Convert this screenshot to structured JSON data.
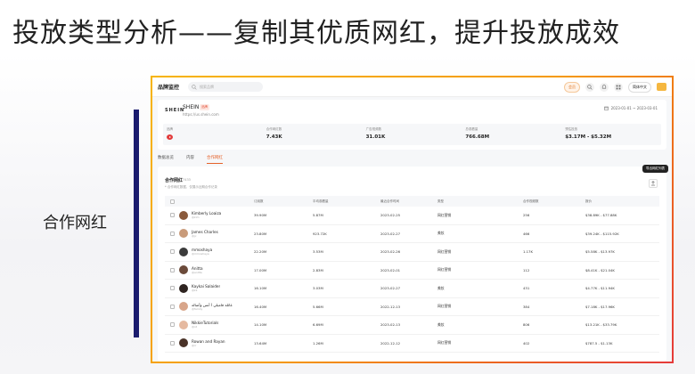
{
  "slide": {
    "title": "投放类型分析——复制其优质网红，提升投放成效",
    "side_label": "合作网红"
  },
  "app": {
    "title": "品牌监控",
    "search_placeholder": "搜索品牌",
    "vip_label": "会员",
    "language": "简体中文"
  },
  "brand": {
    "logo": "SHEIN",
    "name": "SHEIN",
    "badge": "品牌",
    "url": "https://us.shein.com",
    "date_range": "2023-01-01 ~ 2023-03-01",
    "stats": [
      {
        "label": "品牌",
        "value": ""
      },
      {
        "label": "合作网红数",
        "value": "7.43K"
      },
      {
        "label": "广告视频数",
        "value": "31.01K"
      },
      {
        "label": "总观看量",
        "value": "766.68M"
      },
      {
        "label": "预估投放",
        "value": "$3.17M - $5.32M"
      }
    ]
  },
  "tabs": [
    {
      "label": "数据总览",
      "active": false
    },
    {
      "label": "内容",
      "active": false
    },
    {
      "label": "合作网红",
      "active": true
    }
  ],
  "influencers": {
    "title": "合作网红",
    "count": "7433",
    "note": "* 合作网红数据，仅展示近期合作记录",
    "tooltip": "导出网红列表",
    "columns": {
      "name": "",
      "fans": "订阅数",
      "avg": "平均观看量",
      "last": "最近合作时间",
      "type": "类型",
      "videos": "合作视频数",
      "price": "报价"
    },
    "rows": [
      {
        "name": "Kimberly Loaiza",
        "sub": "@kim",
        "fans": "39.90M",
        "avg": "5.87M",
        "last": "2023-02-25",
        "type": "网红营销",
        "videos": "256",
        "price": "$38.89K - $77.88K",
        "avatar_color": "#8a5a3c"
      },
      {
        "name": "James Charles",
        "sub": "@jc",
        "fans": "23.80M",
        "avg": "923.72K",
        "last": "2023-02-27",
        "type": "美妆",
        "videos": "466",
        "price": "$39.24K - $115.92K",
        "avatar_color": "#c99b7a"
      },
      {
        "name": "mmoshaya",
        "sub": "@mmoshaya",
        "fans": "22.20M",
        "avg": "3.53M",
        "last": "2023-02-26",
        "type": "网红营销",
        "videos": "1.17K",
        "price": "$5.58K - $13.97K",
        "avatar_color": "#3b3b3b"
      },
      {
        "name": "Anitta",
        "sub": "@anitta",
        "fans": "17.00M",
        "avg": "2.83M",
        "last": "2023-02-01",
        "type": "网红营销",
        "videos": "112",
        "price": "$8.41K - $21.04K",
        "avatar_color": "#6b4a3a"
      },
      {
        "name": "Kaykai Salaider",
        "sub": "@kk",
        "fans": "16.10M",
        "avg": "3.03M",
        "last": "2023-02-27",
        "type": "美妆",
        "videos": "431",
        "price": "$4.77K - $11.94K",
        "avatar_color": "#2e2420"
      },
      {
        "name": "أنس وأصالة l عائلة فاميلي",
        "sub": "@family",
        "fans": "16.40M",
        "avg": "5.66M",
        "last": "2022-12-13",
        "type": "网红营销",
        "videos": "384",
        "price": "$7.18K - $17.96K",
        "avatar_color": "#d8a58a"
      },
      {
        "name": "NikkieTutorials",
        "sub": "@nt",
        "fans": "14.10M",
        "avg": "6.69M",
        "last": "2023-02-13",
        "type": "美妆",
        "videos": "806",
        "price": "$13.21K - $33.79K",
        "avatar_color": "#e5b9a0"
      },
      {
        "name": "Rowan and Rayan",
        "sub": "@rr",
        "fans": "13.64M",
        "avg": "1.26M",
        "last": "2022-12-12",
        "type": "网红营销",
        "videos": "402",
        "price": "$787.5 - $1.13K",
        "avatar_color": "#4a3328"
      }
    ]
  }
}
